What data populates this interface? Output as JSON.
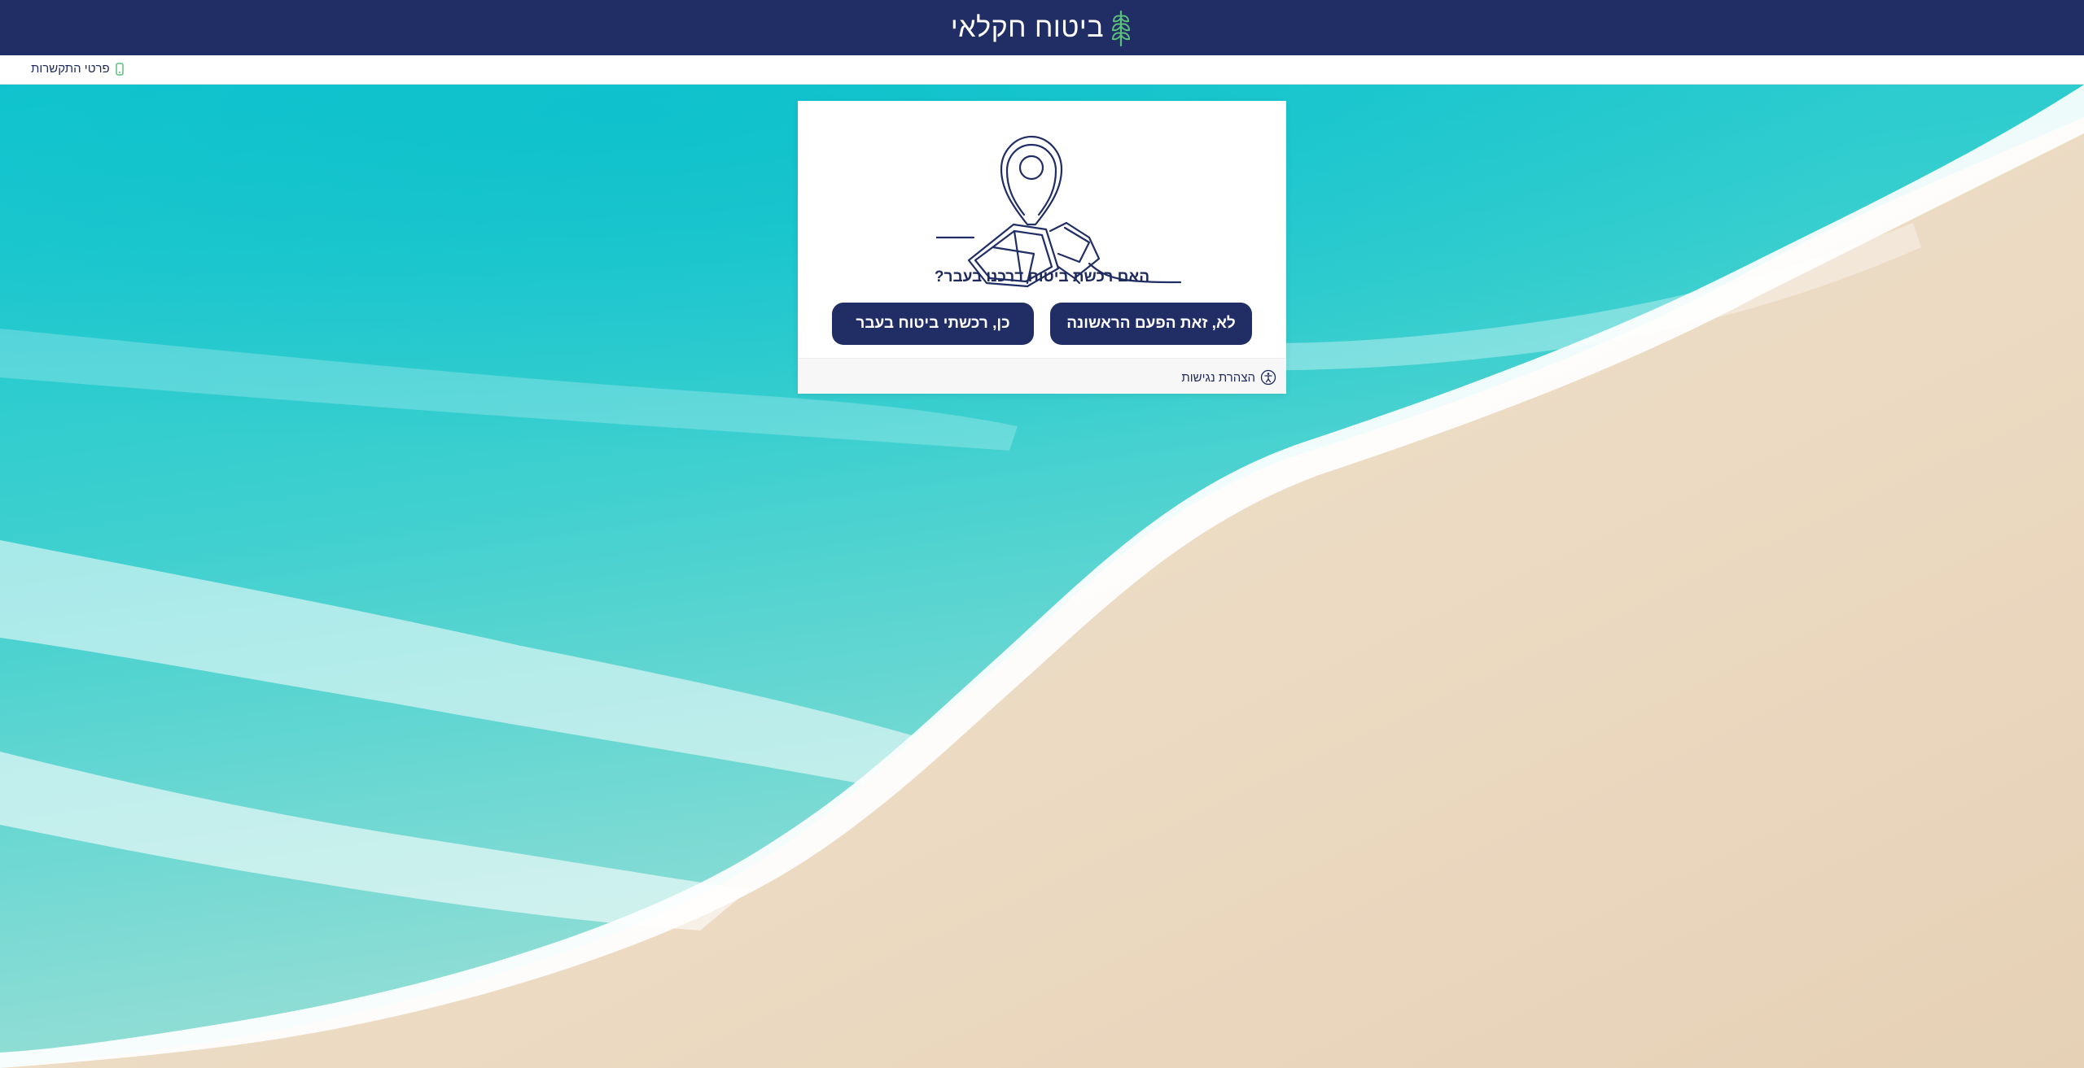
{
  "header": {
    "logo_text": "ביטוח חקלאי",
    "logo_icon": "wheat-icon",
    "background_color": "#212e66",
    "logo_leaf_color": "#5cbf7a"
  },
  "subbar": {
    "contact_label": "פרטי התקשרות",
    "contact_icon": "phone-icon"
  },
  "card": {
    "illustration": "map-pin-field-icon",
    "question": "האם רכשת ביטוח דרכנו בעבר?",
    "buttons": {
      "no_label": "לא, זאת הפעם הראשונה",
      "yes_label": "כן, רכשתי ביטוח בעבר"
    },
    "footer": {
      "accessibility_label": "הצהרת נגישות",
      "accessibility_icon": "accessibility-icon"
    },
    "button_color": "#212e66",
    "text_color": "#1e2a5c"
  },
  "background": {
    "scene": "beach-ocean-background",
    "sea_color": "#1fc7c9",
    "sand_color": "#efdfc9"
  }
}
